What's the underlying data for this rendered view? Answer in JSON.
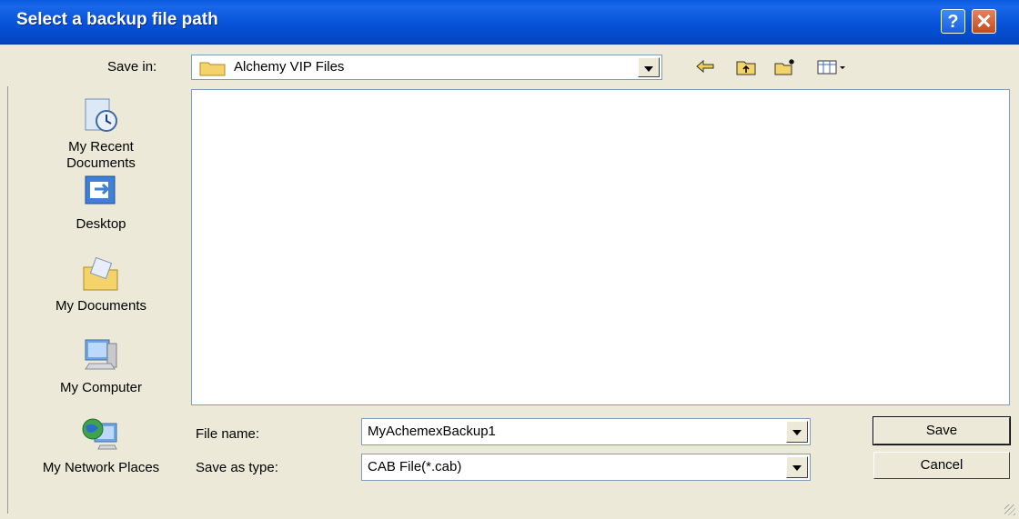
{
  "window": {
    "title": "Select a backup file path"
  },
  "title_buttons": {
    "help": "?",
    "close": "✕"
  },
  "toolbar": {
    "save_in_label": "Save in:",
    "save_in_value": "Alchemy VIP Files",
    "icons": [
      "back-icon",
      "up-folder-icon",
      "new-folder-icon",
      "views-menu-icon"
    ]
  },
  "places": [
    {
      "label": "My Recent Documents",
      "icon": "recent-documents-icon"
    },
    {
      "label": "Desktop",
      "icon": "desktop-icon"
    },
    {
      "label": "My Documents",
      "icon": "my-documents-icon"
    },
    {
      "label": "My Computer",
      "icon": "my-computer-icon"
    },
    {
      "label": "My Network Places",
      "icon": "network-places-icon"
    }
  ],
  "form": {
    "file_name_label": "File name:",
    "file_name_value": "MyAchemexBackup1",
    "save_type_label": "Save as type:",
    "save_type_value": "CAB File(*.cab)"
  },
  "buttons": {
    "save": "Save",
    "cancel": "Cancel"
  },
  "colors": {
    "titlebar": "#0a56d8",
    "dialog_bg": "#ece9d8"
  }
}
